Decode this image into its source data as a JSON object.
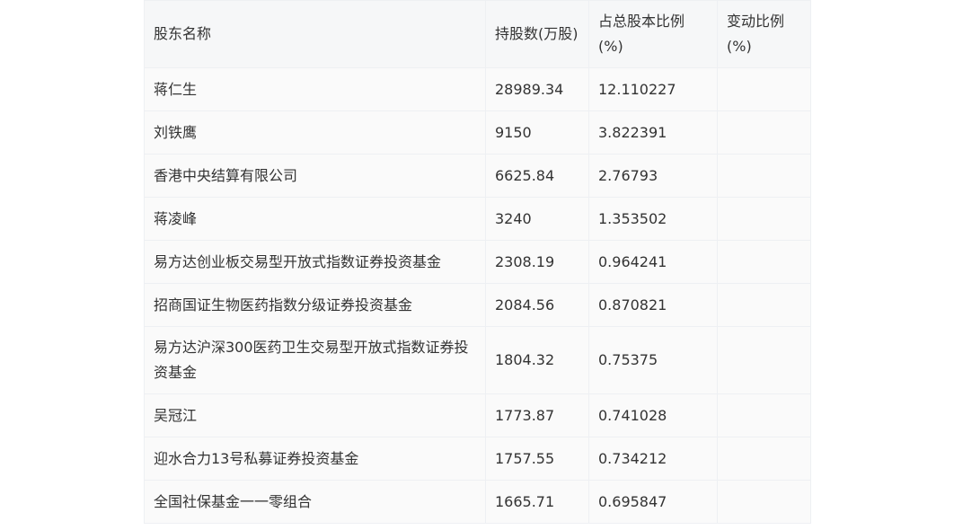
{
  "table": {
    "headers": [
      "股东名称",
      "持股数(万股)",
      "占总股本比例(%)",
      "变动比例(%)"
    ],
    "rows": [
      [
        "蒋仁生",
        "28989.34",
        "12.110227",
        ""
      ],
      [
        "刘铁鹰",
        "9150",
        "3.822391",
        ""
      ],
      [
        "香港中央结算有限公司",
        "6625.84",
        "2.76793",
        ""
      ],
      [
        "蒋凌峰",
        "3240",
        "1.353502",
        ""
      ],
      [
        "易方达创业板交易型开放式指数证券投资基金",
        "2308.19",
        "0.964241",
        ""
      ],
      [
        "招商国证生物医药指数分级证券投资基金",
        "2084.56",
        "0.870821",
        ""
      ],
      [
        "易方达沪深300医药卫生交易型开放式指数证券投资基金",
        "1804.32",
        "0.75375",
        ""
      ],
      [
        "吴冠江",
        "1773.87",
        "0.741028",
        ""
      ],
      [
        "迎水合力13号私募证券投资基金",
        "1757.55",
        "0.734212",
        ""
      ],
      [
        "全国社保基金一一零组合",
        "1665.71",
        "0.695847",
        ""
      ]
    ]
  }
}
